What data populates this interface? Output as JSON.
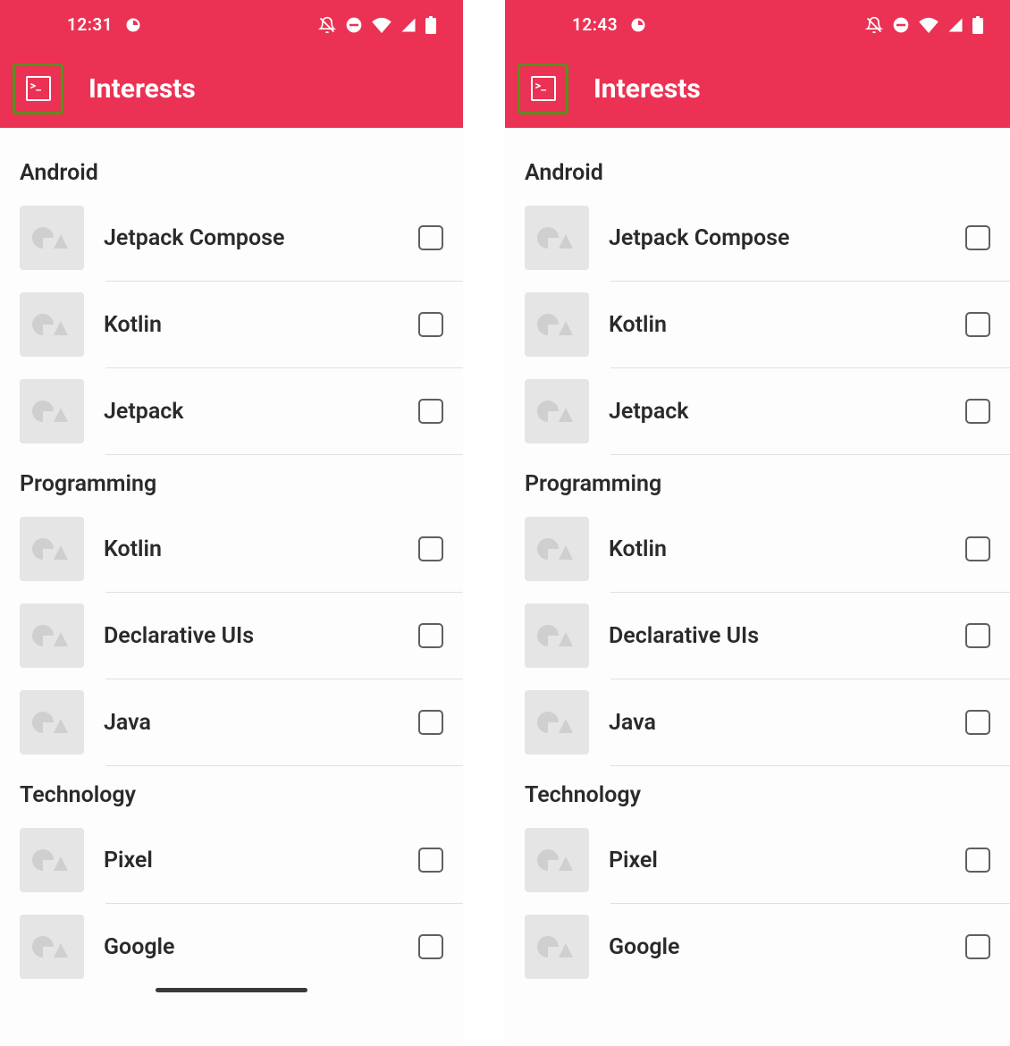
{
  "accent_color": "#eb3254",
  "highlight_border_color": "#5a8f1f",
  "screens": [
    {
      "id": "left",
      "status_time": "12:31",
      "appbar_title": "Interests"
    },
    {
      "id": "right",
      "status_time": "12:43",
      "appbar_title": "Interests"
    }
  ],
  "sections": [
    {
      "title": "Android",
      "items": [
        {
          "label": "Jetpack Compose",
          "checked": false
        },
        {
          "label": "Kotlin",
          "checked": false
        },
        {
          "label": "Jetpack",
          "checked": false
        }
      ]
    },
    {
      "title": "Programming",
      "items": [
        {
          "label": "Kotlin",
          "checked": false
        },
        {
          "label": "Declarative UIs",
          "checked": false
        },
        {
          "label": "Java",
          "checked": false
        }
      ]
    },
    {
      "title": "Technology",
      "items": [
        {
          "label": "Pixel",
          "checked": false
        },
        {
          "label": "Google",
          "checked": false
        }
      ]
    }
  ]
}
